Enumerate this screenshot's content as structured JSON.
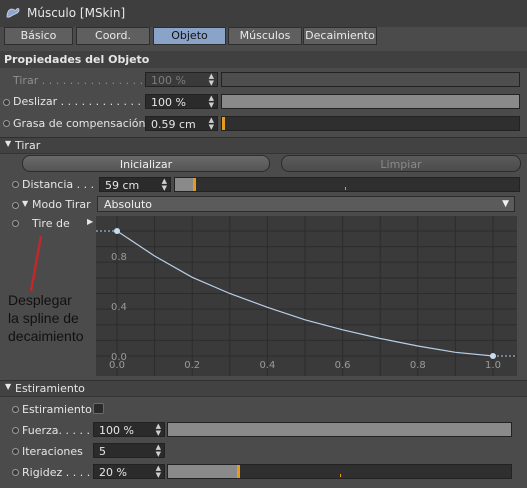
{
  "window": {
    "title": "Músculo [MSkin]"
  },
  "tabs": [
    {
      "label": "Básico",
      "active": false
    },
    {
      "label": "Coord.",
      "active": false
    },
    {
      "label": "Objeto",
      "active": true
    },
    {
      "label": "Músculos",
      "active": false
    },
    {
      "label": "Decaimiento",
      "active": false
    }
  ],
  "object_properties": {
    "header": "Propiedades del Objeto",
    "tirar": {
      "label": "Tirar . . . . . . . . . . . . . . .",
      "value": "100 %",
      "slider_fraction": 0
    },
    "deslizar": {
      "label": "Deslizar . . . . . . . . . . . . .",
      "value": "100 %",
      "slider_fraction": 1.0
    },
    "grasa": {
      "label": "Grasa de compensación",
      "value": "0.59 cm",
      "slider_fraction": 0
    }
  },
  "pull_section": {
    "header": "Tirar",
    "initialize_button": "Inicializar",
    "clear_button": "Limpiar",
    "distance": {
      "label": "Distancia . . .",
      "value": "59 cm"
    },
    "mode": {
      "label": "Modo Tirar",
      "value": "Absoluto"
    },
    "pull_from_label": "Tire de"
  },
  "annotation": {
    "lines": [
      "Desplegar",
      "la spline de",
      "decaimiento"
    ],
    "color": "#c0282a"
  },
  "chart_data": {
    "type": "line",
    "title": "",
    "xlabel": "",
    "ylabel": "",
    "xlim": [
      0.0,
      1.0
    ],
    "ylim": [
      0.0,
      1.0
    ],
    "x_ticks": [
      "0.0",
      "0.2",
      "0.4",
      "0.6",
      "0.8",
      "1.0"
    ],
    "y_ticks": [
      "0.8",
      "0.4",
      "0.0"
    ],
    "series": [
      {
        "x": [
          0.0,
          0.1,
          0.2,
          0.3,
          0.4,
          0.5,
          0.6,
          0.7,
          0.8,
          0.9,
          1.0
        ],
        "values": [
          1.0,
          0.8,
          0.63,
          0.5,
          0.39,
          0.29,
          0.21,
          0.14,
          0.08,
          0.03,
          0.0
        ]
      }
    ],
    "grid": true,
    "line_color": "#b8cfe8"
  },
  "stretch_section": {
    "header": "Estiramiento",
    "estiramiento": {
      "label": "Estiramiento",
      "checked": false
    },
    "fuerza": {
      "label": "Fuerza. . . . .",
      "value": "100 %",
      "slider_fraction": 1.0
    },
    "iteraciones": {
      "label": "Iteraciones",
      "value": "5"
    },
    "rigidez": {
      "label": "Rigidez . . . . .",
      "value": "20 %",
      "slider_fraction": 0.2
    }
  },
  "colors": {
    "accent": "#e89a1e",
    "active_tab": "#8aa3c8"
  }
}
